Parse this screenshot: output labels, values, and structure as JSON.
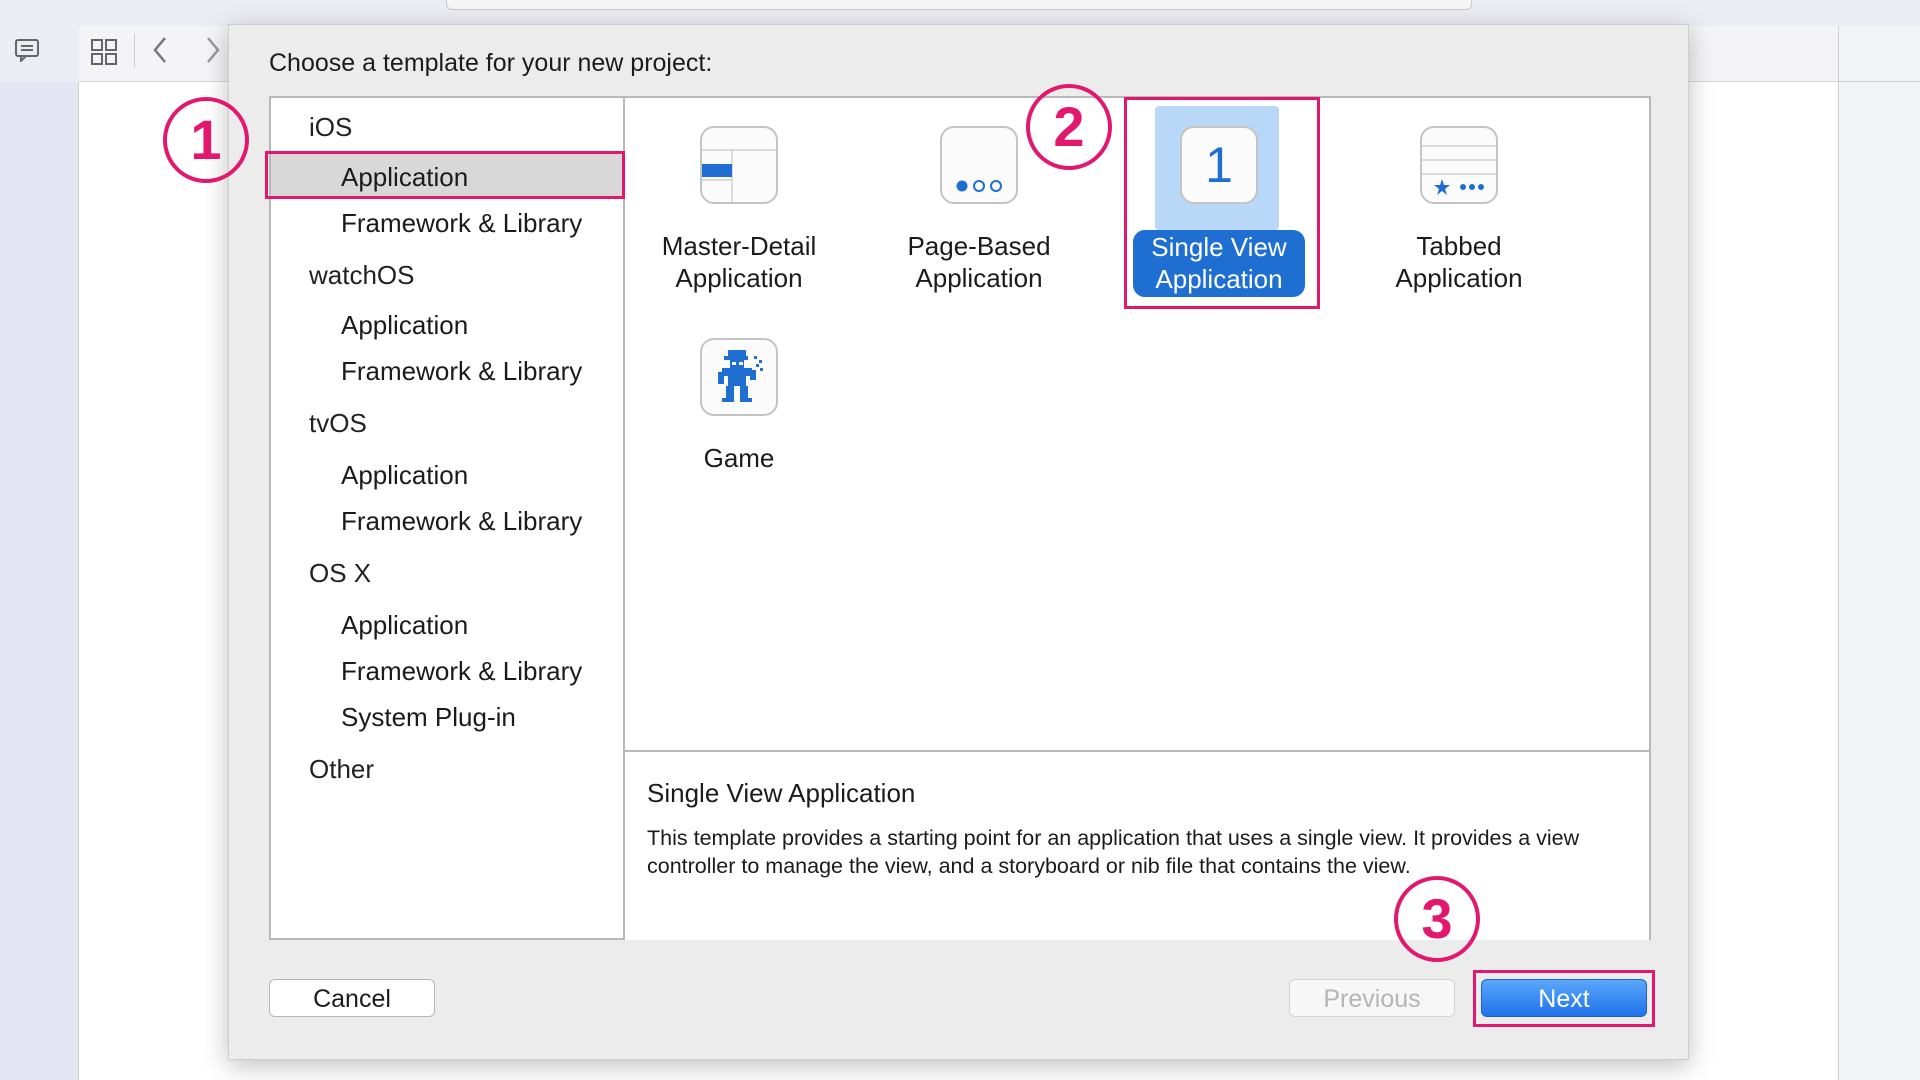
{
  "sheet": {
    "title": "Choose a template for your new project:"
  },
  "sidebar": {
    "groups": [
      {
        "header": "iOS",
        "items": [
          "Application",
          "Framework & Library"
        ]
      },
      {
        "header": "watchOS",
        "items": [
          "Application",
          "Framework & Library"
        ]
      },
      {
        "header": "tvOS",
        "items": [
          "Application",
          "Framework & Library"
        ]
      },
      {
        "header": "OS X",
        "items": [
          "Application",
          "Framework & Library",
          "System Plug-in"
        ]
      },
      {
        "header": "Other",
        "items": []
      }
    ],
    "selected": "iOS / Application"
  },
  "templates": [
    {
      "line1": "Master-Detail",
      "line2": "Application",
      "icon": "master-detail-icon"
    },
    {
      "line1": "Page-Based",
      "line2": "Application",
      "icon": "page-based-icon"
    },
    {
      "line1": "Single View",
      "line2": "Application",
      "icon": "single-view-icon",
      "icon_digit": "1",
      "selected": true
    },
    {
      "line1": "Tabbed",
      "line2": "Application",
      "icon": "tabbed-icon"
    },
    {
      "line1": "Game",
      "line2": "",
      "icon": "game-icon"
    }
  ],
  "description": {
    "title": "Single View Application",
    "text": "This template provides a starting point for an application that uses a single view. It provides a view controller to manage the view, and a storyboard or nib file that contains the view."
  },
  "buttons": {
    "cancel": "Cancel",
    "previous": "Previous",
    "next": "Next"
  },
  "annotations": {
    "step1": "①",
    "step2": "②",
    "step3": "③"
  },
  "colors": {
    "accent": "#1f6fd3",
    "annotation": "#e2186f",
    "selection_bg": "#b9d7f6"
  }
}
